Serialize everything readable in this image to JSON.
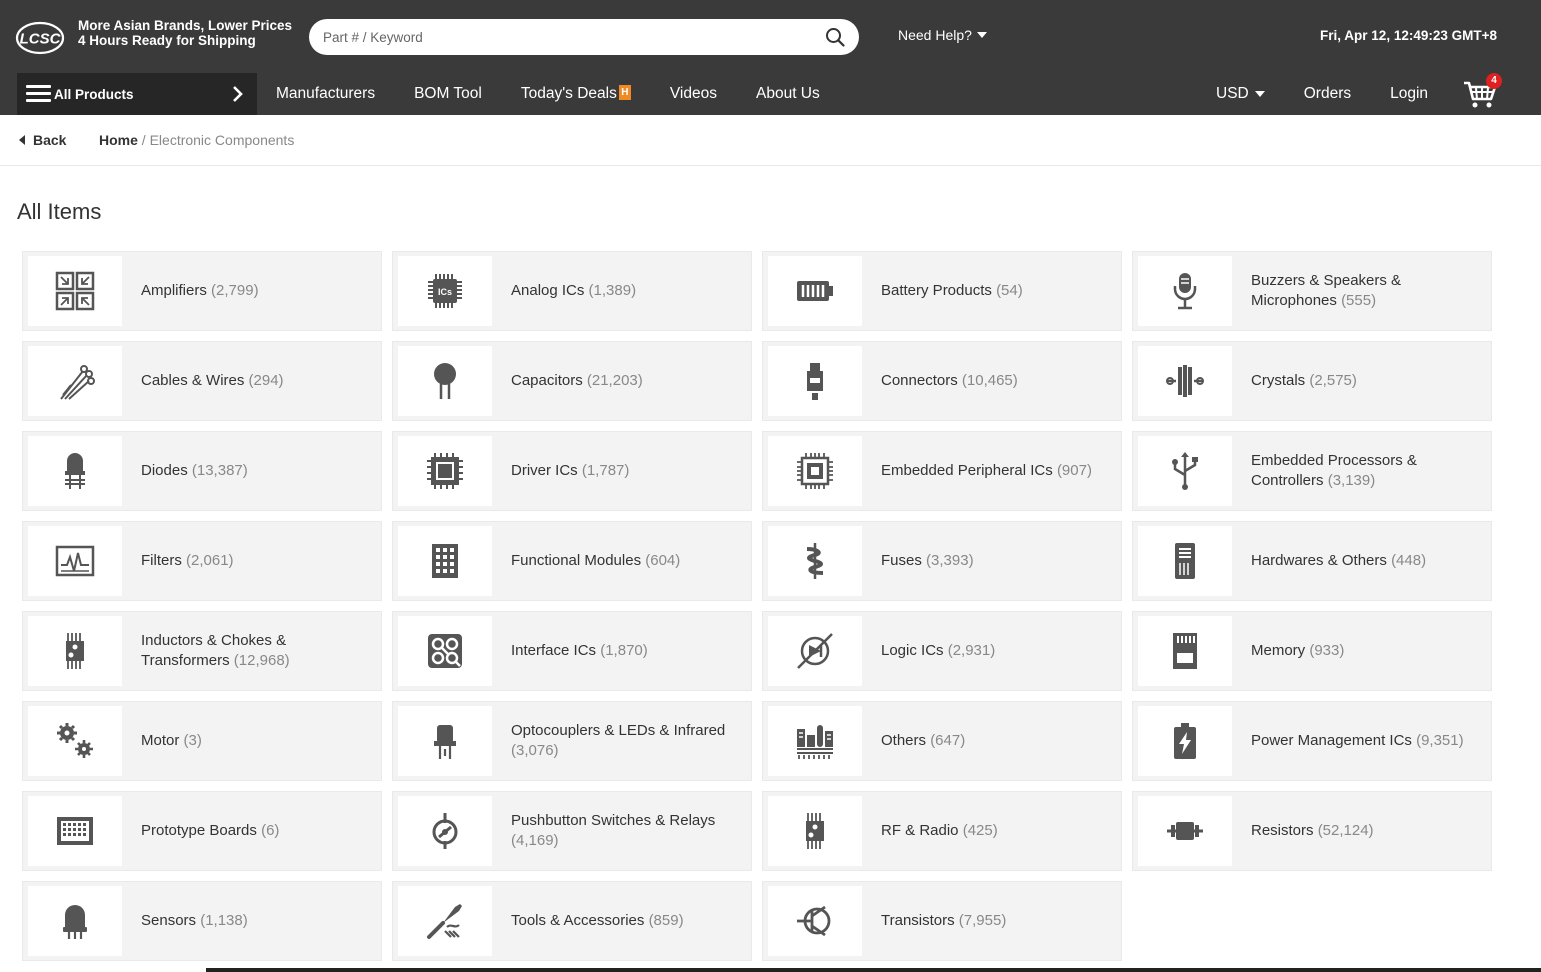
{
  "header": {
    "logo_text": "LCSC",
    "tagline_1": "More Asian Brands, Lower Prices",
    "tagline_2": "4 Hours Ready for Shipping",
    "search_placeholder": "Part # / Keyword",
    "search_icon": "search-icon",
    "help_label": "Need Help?",
    "datetime": "Fri, Apr 12, 12:49:23 GMT+8"
  },
  "nav": {
    "all_products": "All Products",
    "links": [
      "Manufacturers",
      "BOM Tool",
      "Today's Deals",
      "Videos",
      "About Us"
    ],
    "deals_badge": "H",
    "currency": "USD",
    "orders": "Orders",
    "login": "Login",
    "cart_count": "4"
  },
  "breadcrumb": {
    "back": "Back",
    "home": "Home",
    "separator": "/",
    "current": "Electronic Components"
  },
  "page": {
    "title": "All Items"
  },
  "colors": {
    "header_bg": "#3a3a3a",
    "all_products_bg": "#262626",
    "card_bg": "#f3f3f3",
    "icon": "#555555",
    "cart_badge": "#e02020",
    "deals_badge": "#f08a24"
  },
  "categories": [
    {
      "name": "Amplifiers",
      "count": "(2,799)",
      "icon": "amplifier-icon"
    },
    {
      "name": "Analog ICs",
      "count": "(1,389)",
      "icon": "analog-ic-icon"
    },
    {
      "name": "Battery Products",
      "count": "(54)",
      "icon": "battery-icon"
    },
    {
      "name": "Buzzers & Speakers & Microphones",
      "count": "(555)",
      "icon": "microphone-icon"
    },
    {
      "name": "Cables & Wires",
      "count": "(294)",
      "icon": "cable-icon"
    },
    {
      "name": "Capacitors",
      "count": "(21,203)",
      "icon": "capacitor-icon"
    },
    {
      "name": "Connectors",
      "count": "(10,465)",
      "icon": "connector-icon"
    },
    {
      "name": "Crystals",
      "count": "(2,575)",
      "icon": "crystal-icon"
    },
    {
      "name": "Diodes",
      "count": "(13,387)",
      "icon": "diode-icon"
    },
    {
      "name": "Driver ICs",
      "count": "(1,787)",
      "icon": "driver-ic-icon"
    },
    {
      "name": "Embedded Peripheral ICs",
      "count": "(907)",
      "icon": "peripheral-ic-icon"
    },
    {
      "name": "Embedded Processors & Controllers",
      "count": "(3,139)",
      "icon": "usb-icon"
    },
    {
      "name": "Filters",
      "count": "(2,061)",
      "icon": "filter-icon"
    },
    {
      "name": "Functional Modules",
      "count": "(604)",
      "icon": "module-icon"
    },
    {
      "name": "Fuses",
      "count": "(3,393)",
      "icon": "fuse-icon"
    },
    {
      "name": "Hardwares & Others",
      "count": "(448)",
      "icon": "hardware-icon"
    },
    {
      "name": "Inductors & Chokes & Transformers",
      "count": "(12,968)",
      "icon": "inductor-icon"
    },
    {
      "name": "Interface ICs",
      "count": "(1,870)",
      "icon": "interface-ic-icon"
    },
    {
      "name": "Logic ICs",
      "count": "(2,931)",
      "icon": "logic-ic-icon"
    },
    {
      "name": "Memory",
      "count": "(933)",
      "icon": "memory-card-icon"
    },
    {
      "name": "Motor",
      "count": "(3)",
      "icon": "gears-icon"
    },
    {
      "name": "Optocouplers & LEDs & Infrared",
      "count": "(3,076)",
      "icon": "led-icon"
    },
    {
      "name": "Others",
      "count": "(647)",
      "icon": "others-icon"
    },
    {
      "name": "Power Management ICs",
      "count": "(9,351)",
      "icon": "power-icon"
    },
    {
      "name": "Prototype Boards",
      "count": "(6)",
      "icon": "prototype-board-icon"
    },
    {
      "name": "Pushbutton Switches & Relays",
      "count": "(4,169)",
      "icon": "switch-icon"
    },
    {
      "name": "RF & Radio",
      "count": "(425)",
      "icon": "rf-icon"
    },
    {
      "name": "Resistors",
      "count": "(52,124)",
      "icon": "resistor-icon"
    },
    {
      "name": "Sensors",
      "count": "(1,138)",
      "icon": "sensor-icon"
    },
    {
      "name": "Tools & Accessories",
      "count": "(859)",
      "icon": "tools-icon"
    },
    {
      "name": "Transistors",
      "count": "(7,955)",
      "icon": "transistor-icon"
    }
  ]
}
